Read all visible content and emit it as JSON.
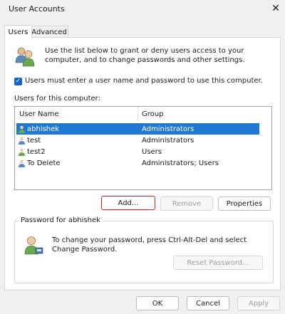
{
  "window": {
    "title": "User Accounts",
    "close_glyph": "✕"
  },
  "tabs": [
    {
      "label": "Users",
      "active": true
    },
    {
      "label": "Advanced",
      "active": false
    }
  ],
  "intro_text": "Use the list below to grant or deny users access to your computer, and to change passwords and other settings.",
  "must_enter_checkbox": {
    "label": "Users must enter a user name and password to use this computer.",
    "checked": true
  },
  "users_for_computer_label": "Users for this computer:",
  "users_table": {
    "columns": [
      "User Name",
      "Group"
    ],
    "rows": [
      {
        "name": "abhishek",
        "group": "Administrators",
        "selected": true
      },
      {
        "name": "test",
        "group": "Administrators",
        "selected": false
      },
      {
        "name": "test2",
        "group": "Users",
        "selected": false
      },
      {
        "name": "To Delete",
        "group": "Administrators; Users",
        "selected": false
      }
    ]
  },
  "buttons": {
    "add": "Add...",
    "remove": "Remove",
    "properties": "Properties",
    "reset_password": "Reset Password...",
    "ok": "OK",
    "cancel": "Cancel",
    "apply": "Apply"
  },
  "password_group": {
    "title": "Password for abhishek",
    "text": "To change your password, press Ctrl-Alt-Del and select Change Password."
  },
  "icons": {
    "users": "users-icon",
    "user": "user-icon",
    "password_user": "user-password-icon"
  },
  "colors": {
    "selection": "#1f78d1",
    "checkbox": "#1464c8",
    "highlight_border": "#d81e1e"
  }
}
